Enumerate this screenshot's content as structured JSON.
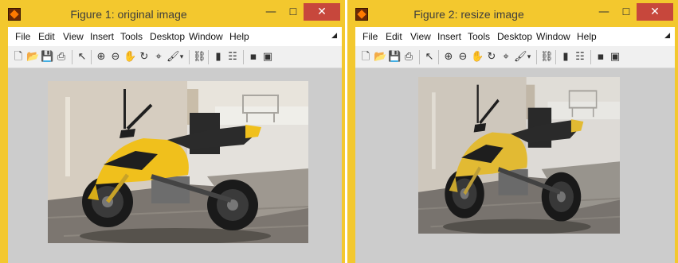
{
  "windows": [
    {
      "title": "Figure 1: original image",
      "controls": {
        "minimize": "—",
        "maximize": "☐",
        "close": "✕"
      },
      "menu": [
        "File",
        "Edit",
        "View",
        "Insert",
        "Tools",
        "Desktop",
        "Window",
        "Help"
      ]
    },
    {
      "title": "Figure 2: resize image",
      "controls": {
        "minimize": "—",
        "maximize": "☐",
        "close": "✕"
      },
      "menu": [
        "File",
        "Edit",
        "View",
        "Insert",
        "Tools",
        "Desktop",
        "Window",
        "Help"
      ]
    }
  ],
  "toolbar_icons": [
    "new-figure-icon",
    "open-file-icon",
    "save-icon",
    "print-icon",
    "pointer-icon",
    "zoom-in-icon",
    "zoom-out-icon",
    "pan-icon",
    "rotate-3d-icon",
    "data-cursor-icon",
    "brush-icon",
    "link-icon",
    "colorbar-icon",
    "legend-icon",
    "hide-plot-tools-icon",
    "show-plot-tools-icon"
  ],
  "colors": {
    "title_bar": "#f3c82e",
    "close_button": "#c7473c",
    "figure_background": "#cccccc"
  }
}
